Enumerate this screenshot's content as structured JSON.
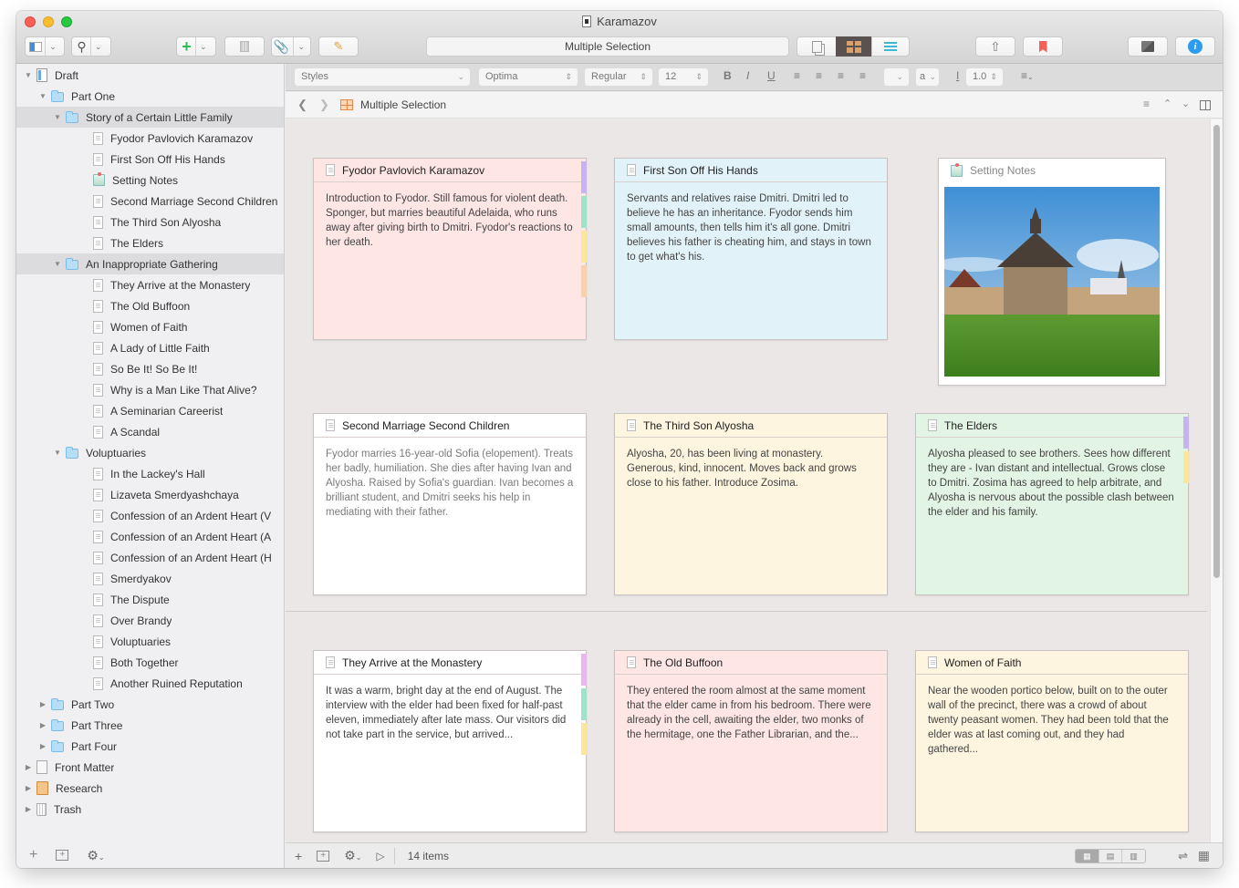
{
  "window": {
    "title": "Karamazov",
    "header_field": "Multiple Selection"
  },
  "toolbar": {
    "buttons": [
      {
        "name": "binder-toggle",
        "icon": "sidebar-icon"
      },
      {
        "name": "quick-search",
        "icon": "search-icon"
      },
      {
        "name": "add",
        "icon": "plus-icon",
        "glyph": "+"
      },
      {
        "name": "trash",
        "icon": "trash-icon"
      },
      {
        "name": "attach",
        "icon": "paperclip-icon"
      },
      {
        "name": "edit",
        "icon": "compose-icon"
      },
      {
        "name": "view-scrivenings",
        "icon": "scrivenings-icon"
      },
      {
        "name": "view-corkboard",
        "icon": "corkboard-icon"
      },
      {
        "name": "view-outline",
        "icon": "outline-icon"
      },
      {
        "name": "share",
        "icon": "share-icon"
      },
      {
        "name": "bookmark",
        "icon": "bookmark-icon"
      },
      {
        "name": "composition",
        "icon": "composition-icon"
      },
      {
        "name": "inspector",
        "icon": "info-icon",
        "glyph": "i"
      }
    ],
    "colors": {
      "add": "#2ebd59",
      "bookmark": "#f0625a",
      "info": "#2a9cf1",
      "outline": "#3ab8d4",
      "corkboard_active": "#5a5250"
    }
  },
  "formatbar": {
    "styles": "Styles",
    "font": "Optima",
    "weight": "Regular",
    "size": "12",
    "bold": "B",
    "italic": "I",
    "underline": "U",
    "case": "a",
    "line_spacing": "1.0"
  },
  "editor_header": {
    "title": "Multiple Selection"
  },
  "binder": {
    "items": [
      {
        "label": "Draft",
        "level": 0,
        "type": "draft",
        "expanded": true
      },
      {
        "label": "Part One",
        "level": 1,
        "type": "folder",
        "expanded": true
      },
      {
        "label": "Story of a Certain Little Family",
        "level": 2,
        "type": "folder",
        "expanded": true,
        "selected": true
      },
      {
        "label": "Fyodor Pavlovich  Karamazov",
        "level": 3,
        "type": "doc"
      },
      {
        "label": "First Son Off His Hands",
        "level": 3,
        "type": "doc"
      },
      {
        "label": "Setting Notes",
        "level": 3,
        "type": "setting"
      },
      {
        "label": "Second Marriage  Second Children",
        "level": 3,
        "type": "doc"
      },
      {
        "label": "The Third Son  Alyosha",
        "level": 3,
        "type": "doc"
      },
      {
        "label": "The Elders",
        "level": 3,
        "type": "doc"
      },
      {
        "label": "An Inappropriate Gathering",
        "level": 2,
        "type": "folder",
        "expanded": true,
        "selected": true
      },
      {
        "label": "They Arrive at the Monastery",
        "level": 3,
        "type": "doc"
      },
      {
        "label": "The Old Buffoon",
        "level": 3,
        "type": "doc"
      },
      {
        "label": "Women of Faith",
        "level": 3,
        "type": "doc"
      },
      {
        "label": "A Lady of Little Faith",
        "level": 3,
        "type": "doc"
      },
      {
        "label": "So Be It! So Be It!",
        "level": 3,
        "type": "doc"
      },
      {
        "label": "Why is a Man Like That Alive?",
        "level": 3,
        "type": "doc"
      },
      {
        "label": "A Seminarian Careerist",
        "level": 3,
        "type": "doc"
      },
      {
        "label": "A Scandal",
        "level": 3,
        "type": "doc"
      },
      {
        "label": "Voluptuaries",
        "level": 2,
        "type": "folder",
        "expanded": true
      },
      {
        "label": "In the Lackey's Hall",
        "level": 3,
        "type": "doc"
      },
      {
        "label": "Lizaveta Smerdyashchaya",
        "level": 3,
        "type": "doc"
      },
      {
        "label": "Confession of an Ardent Heart (V",
        "level": 3,
        "type": "doc"
      },
      {
        "label": "Confession of an Ardent Heart (A",
        "level": 3,
        "type": "doc"
      },
      {
        "label": "Confession of an Ardent Heart (H",
        "level": 3,
        "type": "doc"
      },
      {
        "label": "Smerdyakov",
        "level": 3,
        "type": "doc"
      },
      {
        "label": "The Dispute",
        "level": 3,
        "type": "doc"
      },
      {
        "label": "Over Brandy",
        "level": 3,
        "type": "doc"
      },
      {
        "label": "Voluptuaries",
        "level": 3,
        "type": "doc"
      },
      {
        "label": "Both Together",
        "level": 3,
        "type": "doc"
      },
      {
        "label": "Another Ruined Reputation",
        "level": 3,
        "type": "doc"
      },
      {
        "label": "Part Two",
        "level": 1,
        "type": "folder",
        "expanded": false
      },
      {
        "label": "Part Three",
        "level": 1,
        "type": "folder",
        "expanded": false
      },
      {
        "label": "Part Four",
        "level": 1,
        "type": "folder",
        "expanded": false
      },
      {
        "label": "Front Matter",
        "level": 0,
        "type": "front",
        "expanded": false
      },
      {
        "label": "Research",
        "level": 0,
        "type": "research",
        "expanded": false
      },
      {
        "label": "Trash",
        "level": 0,
        "type": "trash",
        "expanded": false
      }
    ]
  },
  "cards": [
    {
      "title": "Fyodor Pavlovich  Karamazov",
      "body": "Introduction to Fyodor. Still famous for violent death. Sponger, but marries beautiful Adelaida, who runs away after giving birth to Dmitri. Fyodor's reactions to her death.",
      "bg": "#fde6e4",
      "labels": [
        "#c5b4ef",
        "#9fe3c8",
        "#fbe79c",
        "#f9d1ad"
      ],
      "faint": false
    },
    {
      "title": "First Son Off His Hands",
      "body": "Servants and relatives raise Dmitri. Dmitri led to believe he has an inheritance. Fyodor sends him small amounts, then tells him it's all gone. Dmitri believes his father is cheating him, and stays in town to get what's his.",
      "bg": "#e2f2f9",
      "labels": [],
      "faint": false
    },
    {
      "title": "Setting Notes",
      "body": "",
      "bg": "#ffffff",
      "labels": [],
      "image": "monastery-tower-photo",
      "faint": true
    },
    {
      "title": "Second Marriage  Second Children",
      "body": "Fyodor marries 16-year-old Sofia (elopement). Treats her badly, humiliation. She dies after having Ivan and Alyosha. Raised by Sofia's guardian. Ivan becomes a brilliant student, and Dmitri seeks his help in mediating with their father.",
      "bg": "#ffffff",
      "labels": [],
      "faint": true
    },
    {
      "title": "The Third Son  Alyosha",
      "body": "Alyosha, 20, has been living at monastery. Generous, kind, innocent. Moves back and grows close to his father. Introduce Zosima.",
      "bg": "#fdf5df",
      "labels": [],
      "faint": false
    },
    {
      "title": "The Elders",
      "body": "Alyosha pleased to see brothers. Sees how different they are - Ivan distant and intellectual. Grows close to Dmitri. Zosima has agreed to help arbitrate, and Alyosha is nervous about the possible clash between the elder and his family.",
      "bg": "#e2f5e4",
      "labels": [
        "#c5b4ef",
        "#fbe79c"
      ],
      "faint": false
    },
    {
      "title": "They Arrive at the Monastery",
      "body": "It was a warm, bright day at the end of August. The interview with the elder had been fixed for half-past eleven, immediately after late mass. Our visitors did not take part in the service, but arrived...",
      "bg": "#ffffff",
      "labels": [
        "#e9b7ef",
        "#9fe3c8",
        "#fbe79c"
      ],
      "faint": false
    },
    {
      "title": "The Old Buffoon",
      "body": "They entered the room almost at the same moment that the elder came in from his bedroom. There were already in the cell, awaiting the elder, two monks of the hermitage, one the Father Librarian, and the...",
      "bg": "#fde6e4",
      "labels": [],
      "faint": false
    },
    {
      "title": "Women of Faith",
      "body": "Near the wooden portico below, built on to the outer wall of the precinct, there was a crowd of about twenty peasant women. They had been told that the elder was at last coming out, and they had gathered...",
      "bg": "#fdf5df",
      "labels": [],
      "faint": false
    }
  ],
  "footer": {
    "item_count": "14 items"
  }
}
